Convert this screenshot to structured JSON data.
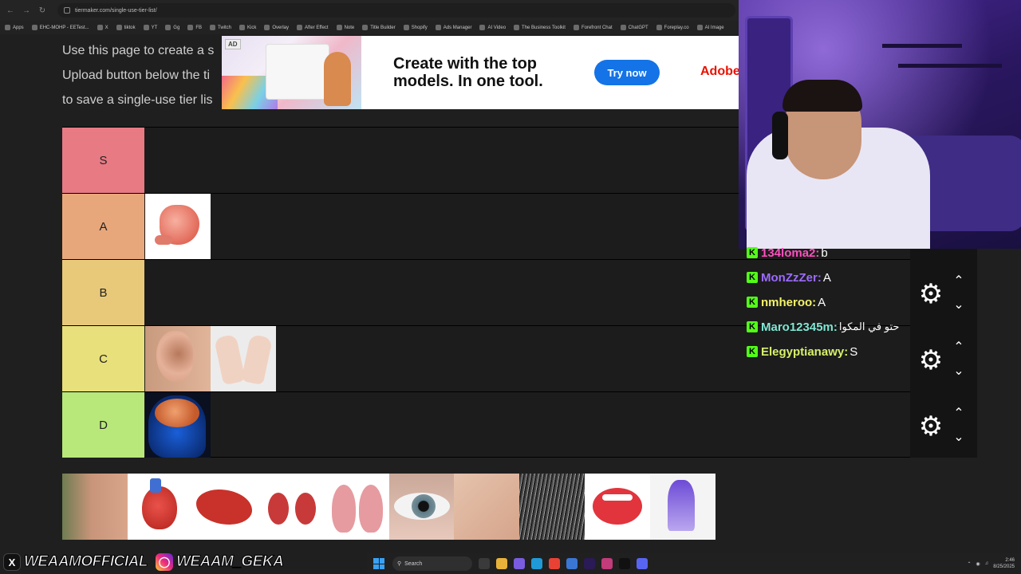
{
  "browser": {
    "url": "tiermaker.com/single-use-tier-list/",
    "bookmarks": [
      "Apps",
      "EHC-MOHP - EETest...",
      "X",
      "tiktok",
      "YT",
      "Gg",
      "FB",
      "Twitch",
      "Kick",
      "Overlay",
      "After Effect",
      "Note",
      "Title Builder",
      "Shopify",
      "Ads Manager",
      "AI Video",
      "The Business Toolkit",
      "Forefront Chat",
      "ChatGPT",
      "Foreplay.co",
      "AI Image"
    ]
  },
  "page": {
    "intro_lines": [
      "Use this page to create a s",
      "Upload button below the ti",
      "to save a single-use tier lis"
    ]
  },
  "ad": {
    "tag": "AD",
    "headline_1": "Create with the top",
    "headline_2": "models. In one tool.",
    "cta": "Try now",
    "brand": "Adobe"
  },
  "tiers": [
    {
      "label": "S",
      "color": "#e87a84",
      "items": []
    },
    {
      "label": "A",
      "color": "#e8a77a",
      "items": [
        "stomach"
      ]
    },
    {
      "label": "B",
      "color": "#e8c97a",
      "items": []
    },
    {
      "label": "C",
      "color": "#e8e07a",
      "items": [
        "ear",
        "hands"
      ]
    },
    {
      "label": "D",
      "color": "#b8e87a",
      "items": [
        "brain"
      ]
    }
  ],
  "pool": [
    "nose",
    "heart",
    "liver",
    "kidneys",
    "lungs",
    "eye",
    "feet",
    "hair",
    "mouth",
    "iron"
  ],
  "chat": [
    {
      "user": "134loma2:",
      "text": "b",
      "color": "#ff4fbf"
    },
    {
      "user": "MonZzZer:",
      "text": "A",
      "color": "#9b6bff"
    },
    {
      "user": "nmheroo:",
      "text": "A",
      "color": "#f3f36a"
    },
    {
      "user": "Maro12345m:",
      "text": "حتو في المكوا",
      "color": "#7fe7d4"
    },
    {
      "user": "Elegyptianawy:",
      "text": "S",
      "color": "#d6f06a"
    }
  ],
  "social": {
    "x_handle": "WEAAMOFFICIAL",
    "ig_handle": "WEAAM_GEKA"
  },
  "taskbar": {
    "search": "Search",
    "time": "2:46",
    "date": "8/25/2025"
  }
}
